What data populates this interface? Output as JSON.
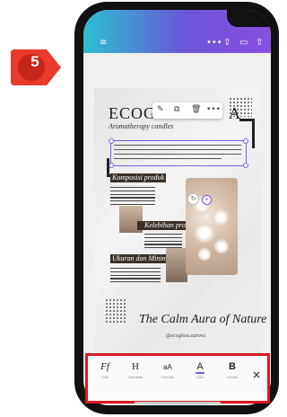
{
  "tutorial": {
    "step": "5"
  },
  "colors": {
    "accent_purple": "#7b5ae0",
    "highlight_red": "#d81b24",
    "badge_red": "#e8392c",
    "topbar_start": "#2bbfd0",
    "topbar_end": "#8a4fe0"
  },
  "topbar": {
    "icons": [
      "menu-icon",
      "more-icon",
      "share-icon",
      "present-icon",
      "upload-icon"
    ]
  },
  "design": {
    "title": "ECOG",
    "title_end": "A",
    "subtitle": "Aromatherapy candles",
    "sections": [
      {
        "title": "Komposisi produk"
      },
      {
        "title": "Kelebihan produk"
      },
      {
        "title": "Ukuran dan Minimalis"
      }
    ],
    "tagline": "The Calm Aura of Nature",
    "handle": "@ecogloss.aurora"
  },
  "context_menu": {
    "icons": [
      "edit-icon",
      "copy-icon",
      "delete-icon",
      "more-icon"
    ]
  },
  "toolbar": {
    "items": [
      {
        "glyph": "Ff",
        "label": "Font"
      },
      {
        "glyph": "H",
        "label": "Text styles"
      },
      {
        "glyph": "aA",
        "label": "Font size"
      },
      {
        "glyph": "A",
        "label": "Color"
      },
      {
        "glyph": "B",
        "label": "Format"
      }
    ],
    "close": "×"
  }
}
